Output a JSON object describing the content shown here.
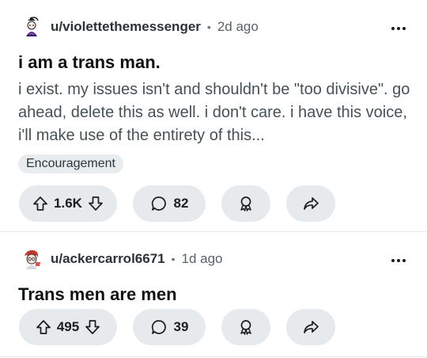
{
  "posts": [
    {
      "username": "u/violettethemessenger",
      "separator": "•",
      "age": "2d ago",
      "title": "i am a trans man.",
      "body": "i exist. my issues isn't and shouldn't be \"too divisive\". go ahead, delete this as well. i don't care. i have this voice, i'll make use of the entirety of this...",
      "flair": "Encouragement",
      "votes": "1.6K",
      "comments": "82"
    },
    {
      "username": "u/ackercarrol6671",
      "separator": "•",
      "age": "1d ago",
      "title": "Trans men are men",
      "votes": "495",
      "comments": "39"
    }
  ],
  "icons": {
    "upvote": "arrow-up-icon",
    "downvote": "arrow-down-icon",
    "comment": "comment-bubble-icon",
    "award": "award-icon",
    "share": "share-arrow-icon",
    "more": "more-horizontal-icon"
  },
  "colors": {
    "button_bg": "#e6eaec",
    "flair_bg": "#e9ecee",
    "body_text": "#465157",
    "meta_text": "#586166"
  }
}
